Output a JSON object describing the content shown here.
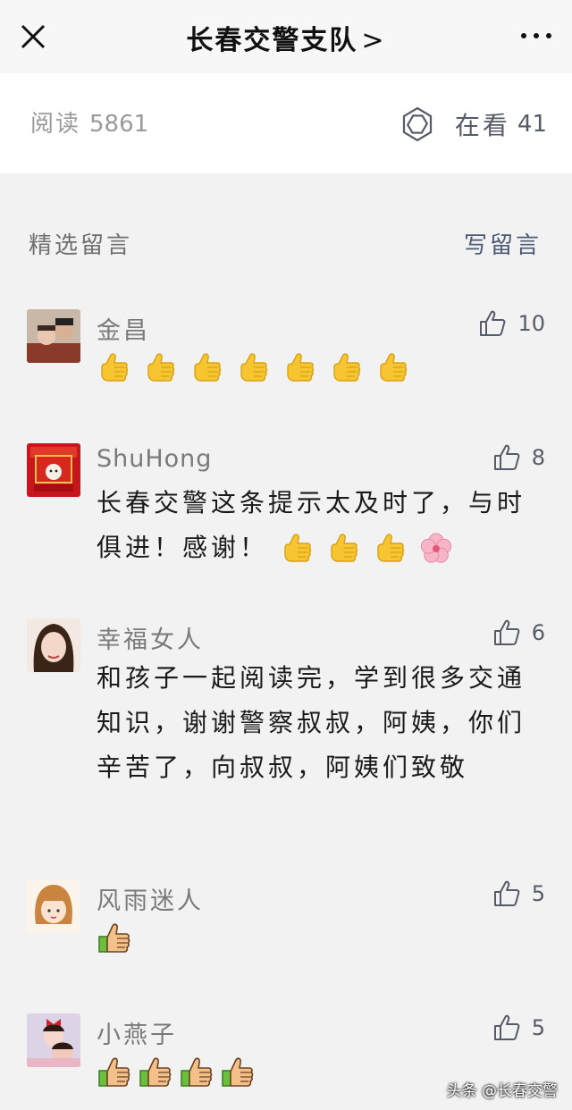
{
  "header": {
    "title": "长春交警支队",
    "chevron": ">"
  },
  "stats": {
    "read_label": "阅读",
    "read_count": "5861",
    "watch_label": "在看",
    "watch_count": "41"
  },
  "section": {
    "title": "精选留言",
    "write_label": "写留言"
  },
  "comments": [
    {
      "name": "金昌",
      "likes": "10",
      "text": "",
      "emoji_count": 7,
      "emoji": "thumbs-up-yellow"
    },
    {
      "name": "ShuHong",
      "likes": "8",
      "text": "长春交警这条提示太及时了，与时俱进！感谢！",
      "emoji_count": 3,
      "emoji": "thumbs-up-yellow",
      "extra_emoji": "cherry-blossom"
    },
    {
      "name": "幸福女人",
      "likes": "6",
      "text": "和孩子一起阅读完，学到很多交通知识，谢谢警察叔叔，阿姨，你们辛苦了，向叔叔，阿姨们致敬"
    },
    {
      "name": "风雨迷人",
      "likes": "5",
      "text": "",
      "emoji_count": 1,
      "emoji": "thumbs-up-outline"
    },
    {
      "name": "小燕子",
      "likes": "5",
      "text": "",
      "emoji_count": 4,
      "emoji": "thumbs-up-outline"
    }
  ],
  "watermark": {
    "text": "头条 @长春交警"
  },
  "colors": {
    "accent": "#555b67",
    "background": "#f2f2f2",
    "thumb_yellow": "#f7c531"
  }
}
